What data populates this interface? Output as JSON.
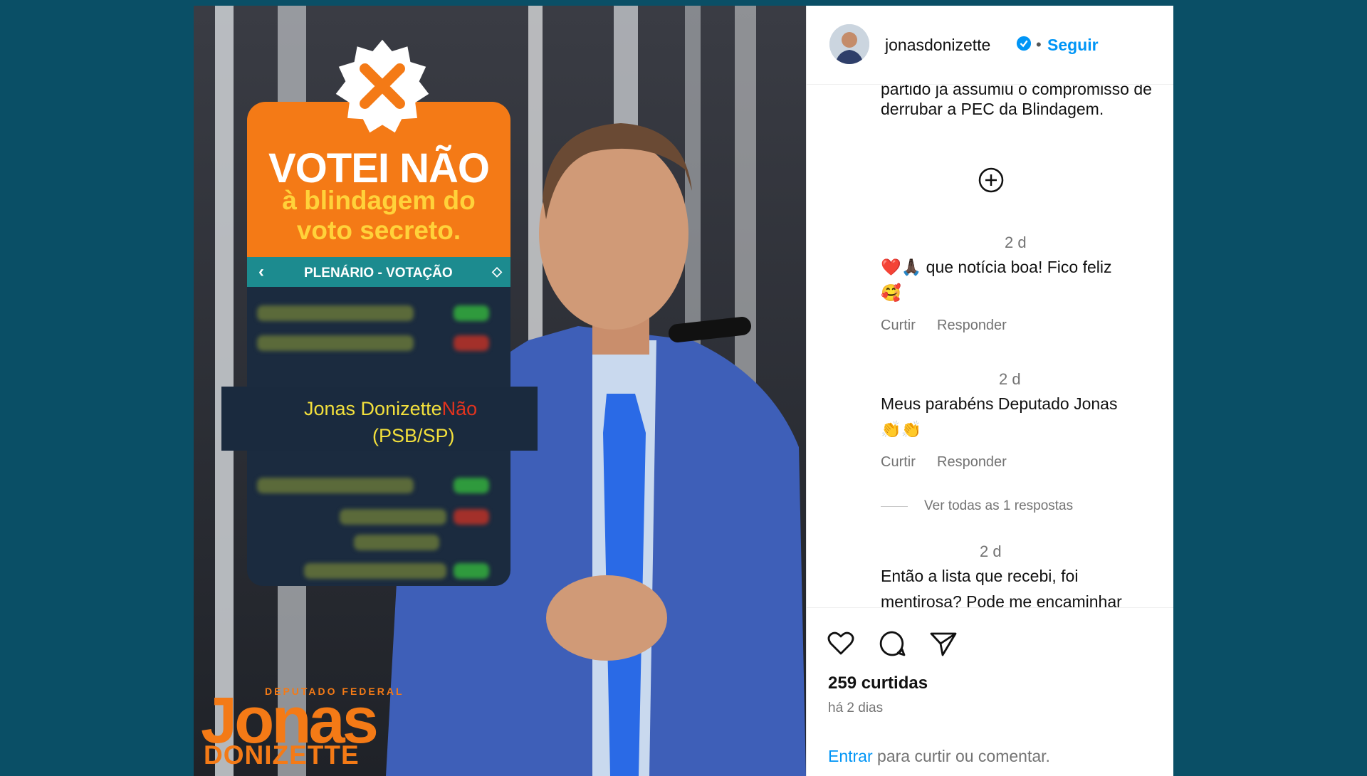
{
  "post_image": {
    "card": {
      "headline": "VOTEI NÃO",
      "subline_1": "à blindagem do",
      "subline_2": "voto secreto.",
      "bar_title": "PLENÁRIO - VOTAÇÃO",
      "highlight_name": "Jonas Donizette",
      "highlight_vote": "Não",
      "highlight_party": "(PSB/SP)"
    },
    "logo": {
      "top_line": "DEPUTADO FEDERAL",
      "first_name": "Jonas",
      "last_name": "DONIZETTE"
    },
    "colors": {
      "brand_orange": "#f47a16",
      "brand_yellow": "#ffd23a"
    }
  },
  "header": {
    "username": "jonasdonizette",
    "separator": "•",
    "follow_label": "Seguir"
  },
  "comments": {
    "caption_tail_1": "partido já assumiu o compromisso de",
    "caption_tail_2": "derrubar a PEC da Blindagem.",
    "items": [
      {
        "time": "2 d",
        "text_1": "❤️🙏🏿 que notícia boa! Fico feliz",
        "text_2": "🥰",
        "like": "Curtir",
        "reply": "Responder"
      },
      {
        "time": "2 d",
        "text_1": "Meus parabéns Deputado Jonas",
        "text_2": "👏👏",
        "like": "Curtir",
        "reply": "Responder"
      },
      {
        "time": "2 d",
        "text_1": "Então a lista que recebi, foi",
        "text_2": "mentirosa? Pode me encaminhar"
      }
    ],
    "view_replies": "Ver todas as 1 respostas"
  },
  "footer": {
    "likes": "259 curtidas",
    "ago": "há 2 dias",
    "login_link": "Entrar",
    "login_text": " para curtir ou comentar."
  }
}
